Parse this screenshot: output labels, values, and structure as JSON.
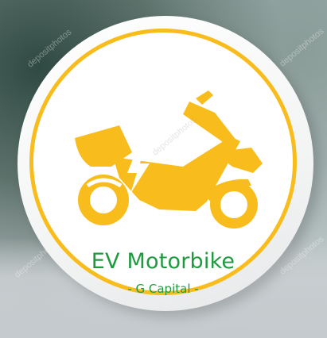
{
  "logo": {
    "title": "EV Motorbike",
    "subtitle": "- G Capital -",
    "icon": "electric-scooter-icon",
    "colors": {
      "ring": "#f8bd1d",
      "bike": "#f8bd1d",
      "bolt": "#ffffff",
      "text": "#1f9a3f"
    }
  },
  "watermark": {
    "text": "depositphotos"
  }
}
